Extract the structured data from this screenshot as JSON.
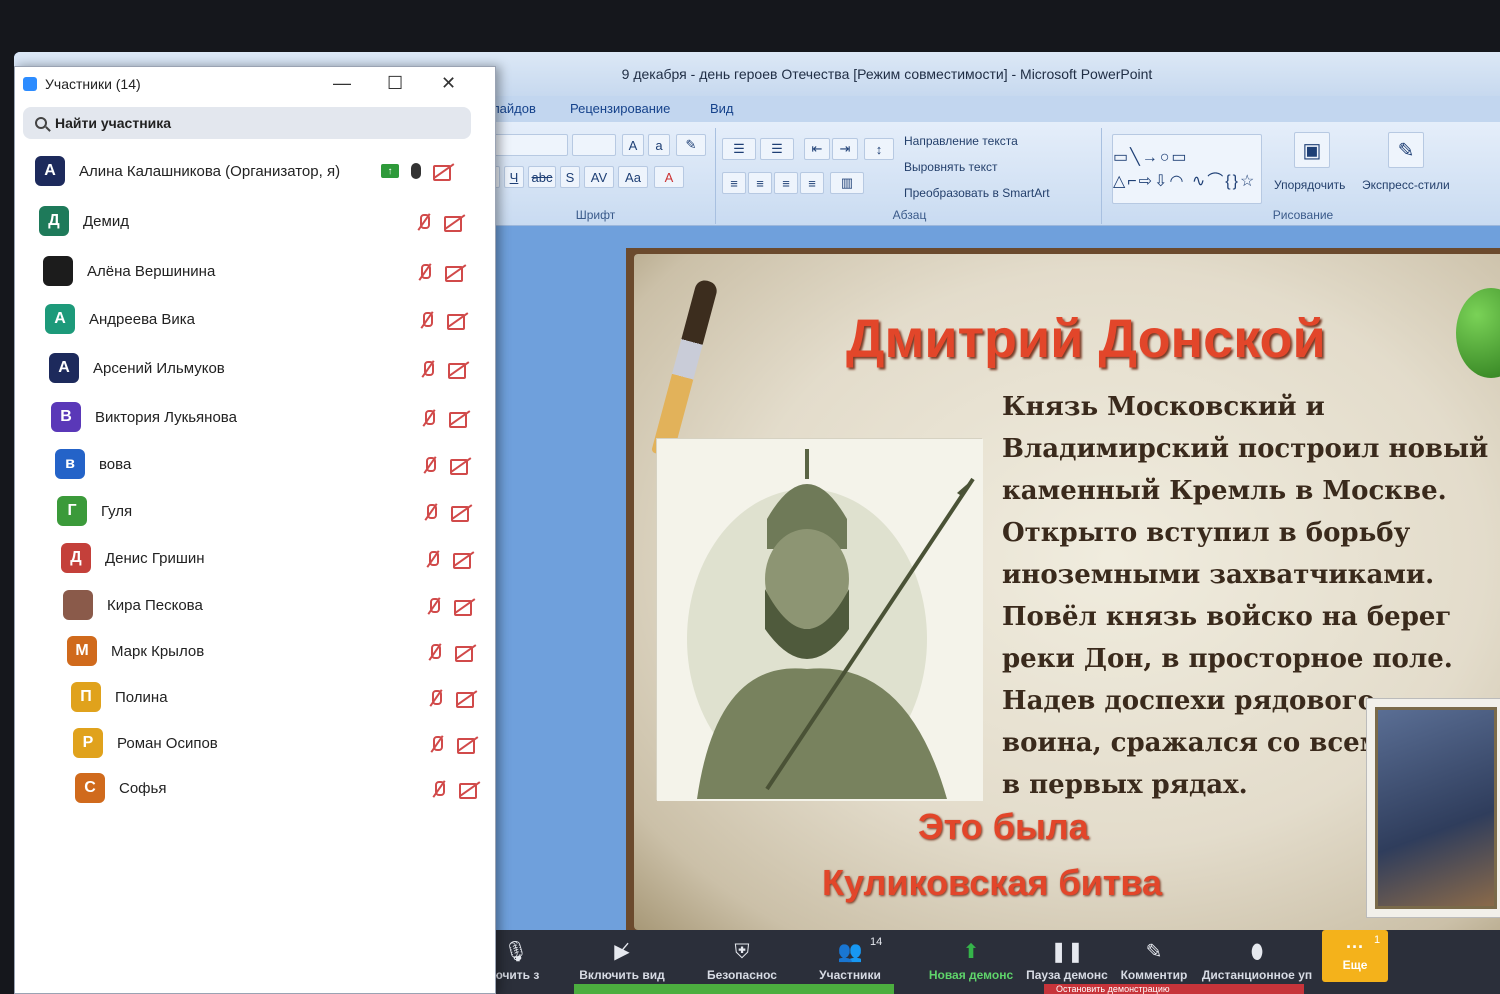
{
  "ppt": {
    "title": "9 декабря - день героев Отечества [Режим совместимости] - Microsoft PowerPoint",
    "tabs": [
      "з слайдов",
      "Рецензирование",
      "Вид"
    ],
    "ribbon": {
      "font_group": "Шрифт",
      "paragraph_group": "Абзац",
      "drawing_group": "Рисование",
      "text_direction": "Направление текста",
      "align_text": "Выровнять текст",
      "smartart": "Преобразовать в SmartArt",
      "arrange": "Упорядочить",
      "quick_styles": "Экспресс-стили"
    },
    "slide": {
      "title": "Дмитрий Донской",
      "body_lines": [
        "Князь Московский и",
        "Владимирский построил новый",
        "каменный Кремль в Москве.",
        "Открыто вступил в борьбу",
        "иноземными захватчиками.",
        "Повёл князь войско  на берег",
        "реки Дон, в  просторное поле.",
        "Надев доспехи рядового",
        "воина, сражался со всеми",
        "в первых  рядах."
      ],
      "conclusion_1": "Это была",
      "conclusion_2": "Куликовская битва"
    }
  },
  "zoom_toolbar": {
    "items": [
      {
        "label": "ючить з",
        "icon": "microphone-icon"
      },
      {
        "label": "Включить вид",
        "icon": "video-off-icon"
      },
      {
        "label": "Безопаснос",
        "icon": "shield-icon"
      },
      {
        "label": "Участники",
        "icon": "participants-icon",
        "badge": "14"
      },
      {
        "label": "Новая демонс",
        "icon": "share-screen-icon"
      },
      {
        "label": "Пауза демонс",
        "icon": "pause-icon"
      },
      {
        "label": "Комментир",
        "icon": "pencil-icon"
      },
      {
        "label": "Дистанционное уп",
        "icon": "mouse-icon"
      }
    ],
    "more_label": "Еще",
    "more_badge": "1",
    "stop_share": "Остановить демонстрацию"
  },
  "participants": {
    "title": "Участники (14)",
    "search_placeholder": "Найти участника",
    "list": [
      {
        "initial": "А",
        "name": "Алина Калашникова (Организатор, я)",
        "color": "#1d2a5c",
        "host": true
      },
      {
        "initial": "Д",
        "name": "Демид",
        "color": "#1e7a5a"
      },
      {
        "initial": "",
        "name": "Алёна Вершинина",
        "color": "#1c1c1c"
      },
      {
        "initial": "А",
        "name": "Андреева Вика",
        "color": "#1d9a7a"
      },
      {
        "initial": "А",
        "name": "Арсений Ильмуков",
        "color": "#1d2a5c"
      },
      {
        "initial": "В",
        "name": "Виктория Лукьянова",
        "color": "#5a38b8"
      },
      {
        "initial": "в",
        "name": "вова",
        "color": "#2463c8"
      },
      {
        "initial": "Г",
        "name": "Гуля",
        "color": "#3b9a3a"
      },
      {
        "initial": "Д",
        "name": "Денис Гришин",
        "color": "#c4403a"
      },
      {
        "initial": "",
        "name": "Кира Пескова",
        "color": "#8a5a4a"
      },
      {
        "initial": "М",
        "name": "Марк Крылов",
        "color": "#d06a1c"
      },
      {
        "initial": "П",
        "name": "Полина",
        "color": "#e0a21c"
      },
      {
        "initial": "Р",
        "name": "Роман Осипов",
        "color": "#e0a21c"
      },
      {
        "initial": "С",
        "name": "Софья",
        "color": "#d06a1c"
      }
    ]
  }
}
